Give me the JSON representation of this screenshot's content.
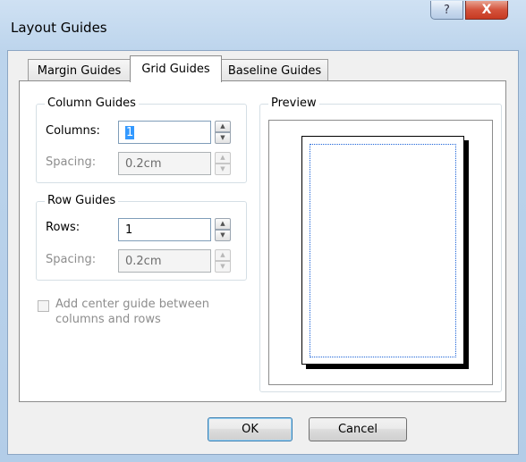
{
  "window": {
    "title": "Layout Guides",
    "help_glyph": "?",
    "close_glyph": "X"
  },
  "tabs": [
    {
      "label": "Margin Guides"
    },
    {
      "label": "Grid Guides"
    },
    {
      "label": "Baseline Guides"
    }
  ],
  "column_guides": {
    "legend": "Column Guides",
    "columns_label": "Columns:",
    "columns_value": "1",
    "spacing_label": "Spacing:",
    "spacing_value": "0.2cm"
  },
  "row_guides": {
    "legend": "Row Guides",
    "rows_label": "Rows:",
    "rows_value": "1",
    "spacing_label": "Spacing:",
    "spacing_value": "0.2cm"
  },
  "center_guide": {
    "label_line1": "Add center guide between",
    "label_line2": "columns and rows",
    "checked": false
  },
  "preview": {
    "legend": "Preview"
  },
  "buttons": {
    "ok": "OK",
    "cancel": "Cancel"
  },
  "icons": {
    "help": "help-icon",
    "close": "close-icon",
    "spin_up": "spin-up-arrow-icon",
    "spin_down": "spin-down-arrow-icon"
  },
  "colors": {
    "guide_line": "#1c63d8",
    "close_button": "#c73a22"
  }
}
